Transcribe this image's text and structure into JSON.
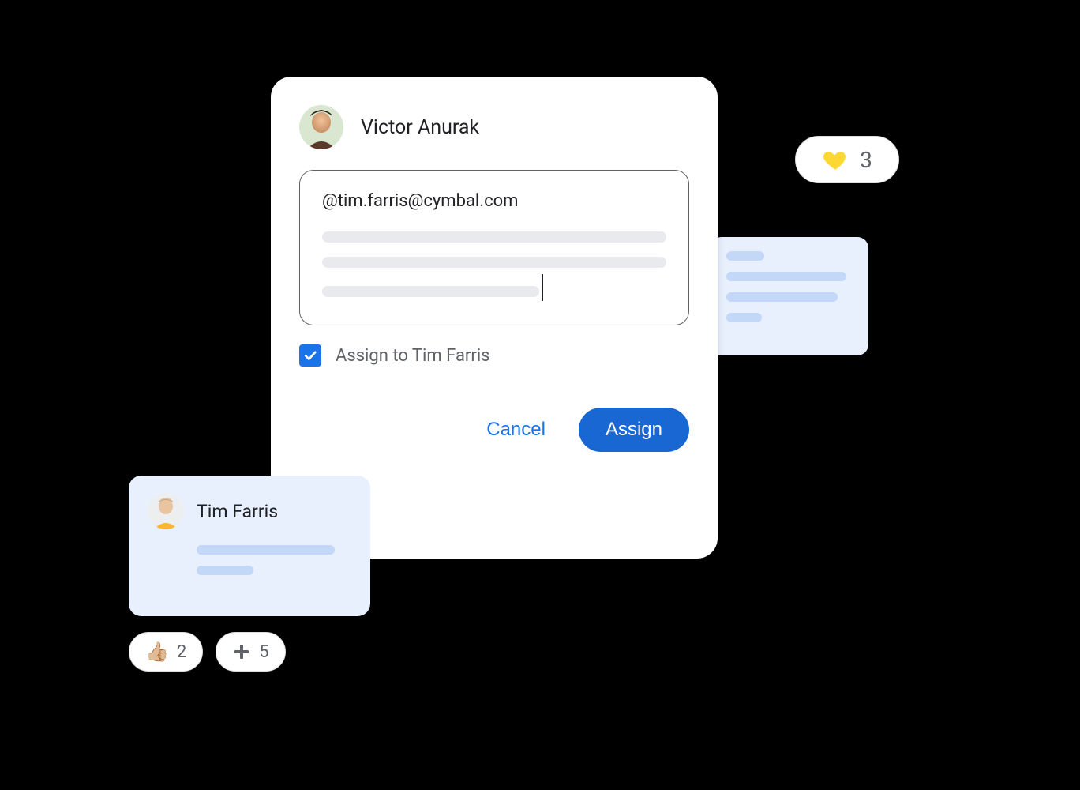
{
  "comment": {
    "author_name": "Victor Anurak",
    "mention_text": "@tim.farris@cymbal.com",
    "assign_label": "Assign to Tim Farris",
    "assign_checked": true,
    "cancel_label": "Cancel",
    "assign_button_label": "Assign"
  },
  "reply": {
    "author_name": "Tim Farris"
  },
  "reactions": {
    "heart_count": "3",
    "thumbs_count": "2",
    "plus_count": "5",
    "thumbs_emoji": "👍🏼"
  }
}
